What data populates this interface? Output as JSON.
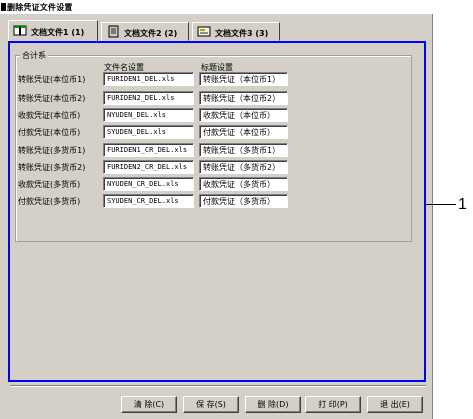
{
  "window": {
    "title": "删除凭证文件设置"
  },
  "tabs": [
    {
      "label": "文档文件1 (1)",
      "icon": "book-icon"
    },
    {
      "label": "文档文件2 (2)",
      "icon": "notebook-icon"
    },
    {
      "label": "文档文件3 (3)",
      "icon": "document-icon"
    }
  ],
  "group": {
    "label": "合计系"
  },
  "headers": {
    "filename": "文件名设置",
    "title": "标题设置"
  },
  "rows": [
    {
      "label": "转账凭证(本位币1)",
      "filename": "FURIDEN1_DEL.xls",
      "title": "转账凭证（本位币1）"
    },
    {
      "label": "转账凭证(本位币2)",
      "filename": "FURIDEN2_DEL.xls",
      "title": "转账凭证（本位币2）"
    },
    {
      "label": "收款凭证(本位币)",
      "filename": "NYUDEN_DEL.xls",
      "title": "收款凭证（本位币）"
    },
    {
      "label": "付款凭证(本位币)",
      "filename": "SYUDEN_DEL.xls",
      "title": "付款凭证（本位币）"
    },
    {
      "label": "转账凭证(多货币1)",
      "filename": "FURIDEN1_CR_DEL.xls",
      "title": "转账凭证（多货币1）"
    },
    {
      "label": "转账凭证(多货币2)",
      "filename": "FURIDEN2_CR_DEL.xls",
      "title": "转账凭证（多货币2）"
    },
    {
      "label": "收款凭证(多货币)",
      "filename": "NYUDEN_CR_DEL.xls",
      "title": "收款凭证（多货币）"
    },
    {
      "label": "付款凭证(多货币)",
      "filename": "SYUDEN_CR_DEL.xls",
      "title": "付款凭证（多货币）"
    }
  ],
  "buttons": {
    "clear": "清 除(C)",
    "save": "保 存(S)",
    "delete": "删 除(D)",
    "print": "打 印(P)",
    "exit": "退 出(E)"
  },
  "callout": "1",
  "colors": {
    "highlight": "#0000ff",
    "face": "#d4d0c8"
  }
}
